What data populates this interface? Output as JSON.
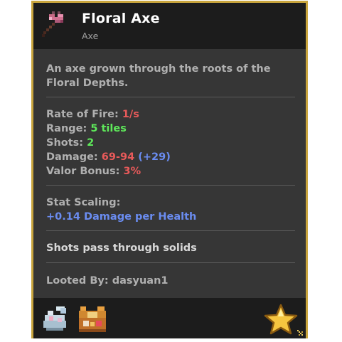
{
  "item": {
    "name": "Floral Axe",
    "type": "Axe",
    "description": "An axe grown through the roots of the Floral Depths."
  },
  "stats": {
    "rate_of_fire_label": "Rate of Fire:",
    "rate_of_fire_value": "1/s",
    "range_label": "Range:",
    "range_value": "5 tiles",
    "shots_label": "Shots:",
    "shots_value": "2",
    "damage_label": "Damage:",
    "damage_value": "69-94",
    "damage_bonus": "(+29)",
    "valor_label": "Valor Bonus:",
    "valor_value": "3%"
  },
  "scaling": {
    "label": "Stat Scaling:",
    "value": "+0.14 Damage per Health"
  },
  "special": "Shots pass through solids",
  "looted": {
    "label": "Looted By:",
    "player": "dasyuan1"
  },
  "colors": {
    "border": "#c9a53d",
    "stat_red": "#e85a5a",
    "stat_green": "#5ee85a",
    "stat_blue": "#6a8cf0"
  },
  "icons": [
    "floral-axe-icon",
    "sack-icon",
    "treasure-chest-icon",
    "star-icon",
    "resize-grip-icon"
  ]
}
